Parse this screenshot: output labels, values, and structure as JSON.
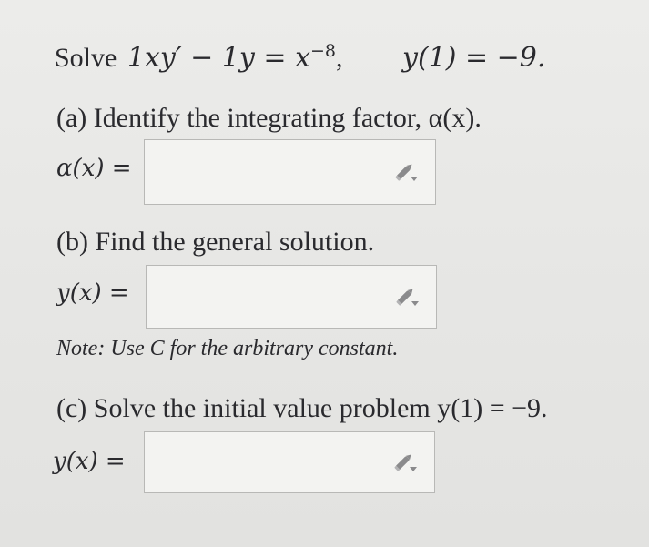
{
  "problem": {
    "statement_prefix": "Solve",
    "equation": "1xy′ − 1y = x",
    "exponent": "−8",
    "separator": ",",
    "initial_condition": "y(1) = −9."
  },
  "part_a": {
    "prompt": "(a) Identify the integrating factor, α(x).",
    "answer_label": "α(x) =",
    "answer_value": "",
    "edit_icon": "pencil-edit-icon"
  },
  "part_b": {
    "prompt": "(b) Find the general solution.",
    "answer_label": "y(x) =",
    "answer_value": "",
    "edit_icon": "pencil-edit-icon",
    "note": "Note: Use C for the arbitrary constant."
  },
  "part_c": {
    "prompt": "(c) Solve the initial value problem y(1) = −9.",
    "answer_label": "y(x) =",
    "answer_value": "",
    "edit_icon": "pencil-edit-icon"
  }
}
